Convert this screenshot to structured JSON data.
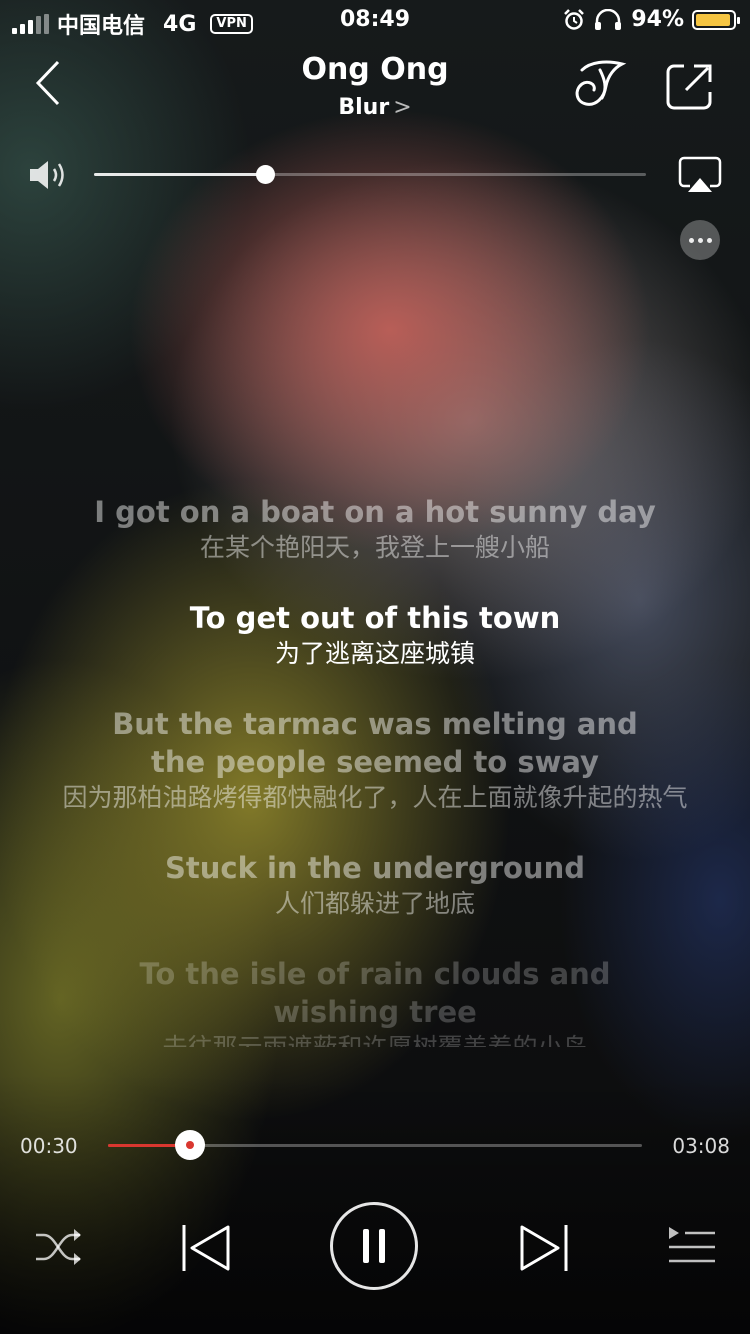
{
  "status_bar": {
    "carrier": "中国电信",
    "network": "4G",
    "vpn": "VPN",
    "time": "08:49",
    "battery_percent": "94%",
    "battery_level": 0.94,
    "battery_color": "#f5c542"
  },
  "header": {
    "song_title": "Ong Ong",
    "artist": "Blur",
    "artist_chevron": ">"
  },
  "volume": {
    "level": 0.31
  },
  "lyrics": [
    {
      "en": "I got on a boat on a hot sunny day",
      "zh": "在某个艳阳天，我登上一艘小船",
      "state": "past"
    },
    {
      "en": "To get out of this town",
      "zh": "为了逃离这座城镇",
      "state": "current"
    },
    {
      "en": "But the tarmac was melting and the people seemed to sway",
      "zh": "因为那柏油路烤得都快融化了，人在上面就像升起的热气",
      "state": "next"
    },
    {
      "en": "Stuck in the underground",
      "zh": "人们都躲进了地底",
      "state": "next"
    },
    {
      "en": "To the isle of rain clouds and wishing tree",
      "zh": "去往那云雨遮蔽和许愿树覆盖着的小岛",
      "state": "fade"
    }
  ],
  "progress": {
    "current": "00:30",
    "total": "03:08",
    "fraction": 0.153,
    "accent": "#d9372f"
  },
  "icons": {
    "back": "back-chevron-icon",
    "ringtone": "ringtone-icon",
    "share": "share-icon",
    "speaker": "speaker-icon",
    "airplay": "airplay-icon",
    "more": "more-icon",
    "shuffle": "shuffle-icon",
    "previous": "previous-icon",
    "pause": "pause-icon",
    "next": "next-icon",
    "playlist": "playlist-icon"
  }
}
